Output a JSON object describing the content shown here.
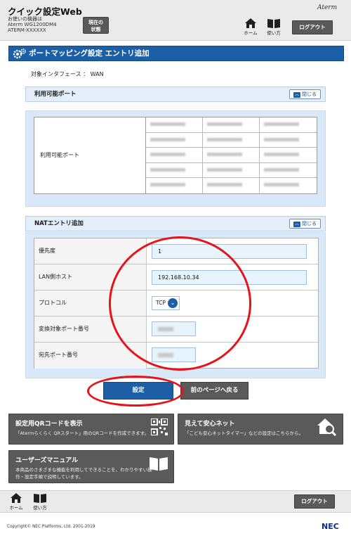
{
  "header": {
    "app_title": "クイック設定Web",
    "device_caption": "お使いの機器は",
    "device_model": "Aterm WG1200DM4",
    "device_name": "ATERM-XXXXXX",
    "status_button_line1": "現在の",
    "status_button_line2": "状態",
    "brand": "Aterm",
    "home_label": "ホーム",
    "manual_label": "使い方",
    "logout_label": "ログアウト"
  },
  "page": {
    "title": "ポートマッピング設定 エントリ追加",
    "interface_text": "対象インタフェース ： WAN"
  },
  "available_ports": {
    "heading": "利用可能ポート",
    "close_label": "閉じる",
    "row_label": "利用可能ポート"
  },
  "nat": {
    "heading": "NATエントリ追加",
    "close_label": "閉じる",
    "priority_label": "優先度",
    "priority_value": "1",
    "lan_host_label": "LAN側ホスト",
    "lan_host_value": "192.168.10.34",
    "protocol_label": "プロトコル",
    "protocol_value": "TCP",
    "convert_port_label": "変換対象ポート番号",
    "dest_port_label": "宛先ポート番号"
  },
  "actions": {
    "setting_label": "設定",
    "back_label": "前のページへ戻る"
  },
  "tiles": {
    "qr_title": "設定用QRコードを表示",
    "qr_desc": "「Atermらくらく QRスタート」用のQRコードを作成できます。",
    "safety_title": "見えて安心ネット",
    "safety_desc": "「こども安心ネットタイマー」などの設定はこちらから。",
    "manual_title": "ユーザーズマニュアル",
    "manual_desc1": "本商品のさまざまな機能を利用してできることを、わかりやすい操",
    "manual_desc2": "作・設定手順で説明しています。"
  },
  "footer": {
    "home_label": "ホーム",
    "manual_label": "使い方",
    "logout_label": "ログアウト",
    "copyright": "Copyright© NEC Platforms, Ltd. 2001-2019",
    "nec": "NEC"
  },
  "colors": {
    "accent": "#1c5fa6",
    "dark_button": "#5a5a5a",
    "panel": "#dae9f7",
    "annotation": "#e4141b"
  }
}
